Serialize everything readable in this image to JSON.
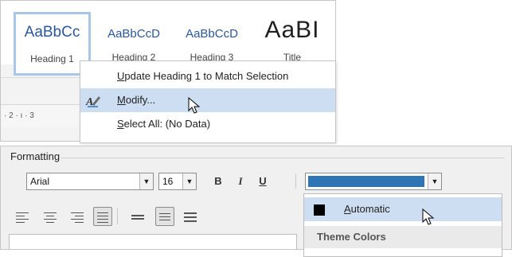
{
  "styles_gallery": {
    "tiles": [
      {
        "sample": "AaBbCc",
        "name": "Heading 1"
      },
      {
        "sample": "AaBbCcD",
        "name": "Heading 2"
      },
      {
        "sample": "AaBbCcD",
        "name": "Heading 3"
      },
      {
        "sample": "AaBI",
        "name": "Title"
      }
    ]
  },
  "ruler": {
    "text": "· 2 · ı · 3"
  },
  "context_menu": {
    "items": [
      {
        "label": "Update Heading 1 to Match Selection",
        "icon": null
      },
      {
        "label": "Modify...",
        "icon": "modify-style-icon",
        "highlighted": true
      },
      {
        "label": "Select All: (No Data)",
        "icon": null
      }
    ]
  },
  "formatting": {
    "title": "Formatting",
    "font": "Arial",
    "size": "16",
    "bold_label": "B",
    "italic_label": "I",
    "underline_label": "U",
    "font_color": "#2E75B6",
    "dropdown_arrow": "▼"
  },
  "color_dropdown": {
    "automatic_label": "Automatic",
    "automatic_color": "#000000",
    "theme_colors_header": "Theme Colors"
  },
  "colors": {
    "highlight": "#CDDDF2",
    "accent_text": "#2B579A"
  }
}
